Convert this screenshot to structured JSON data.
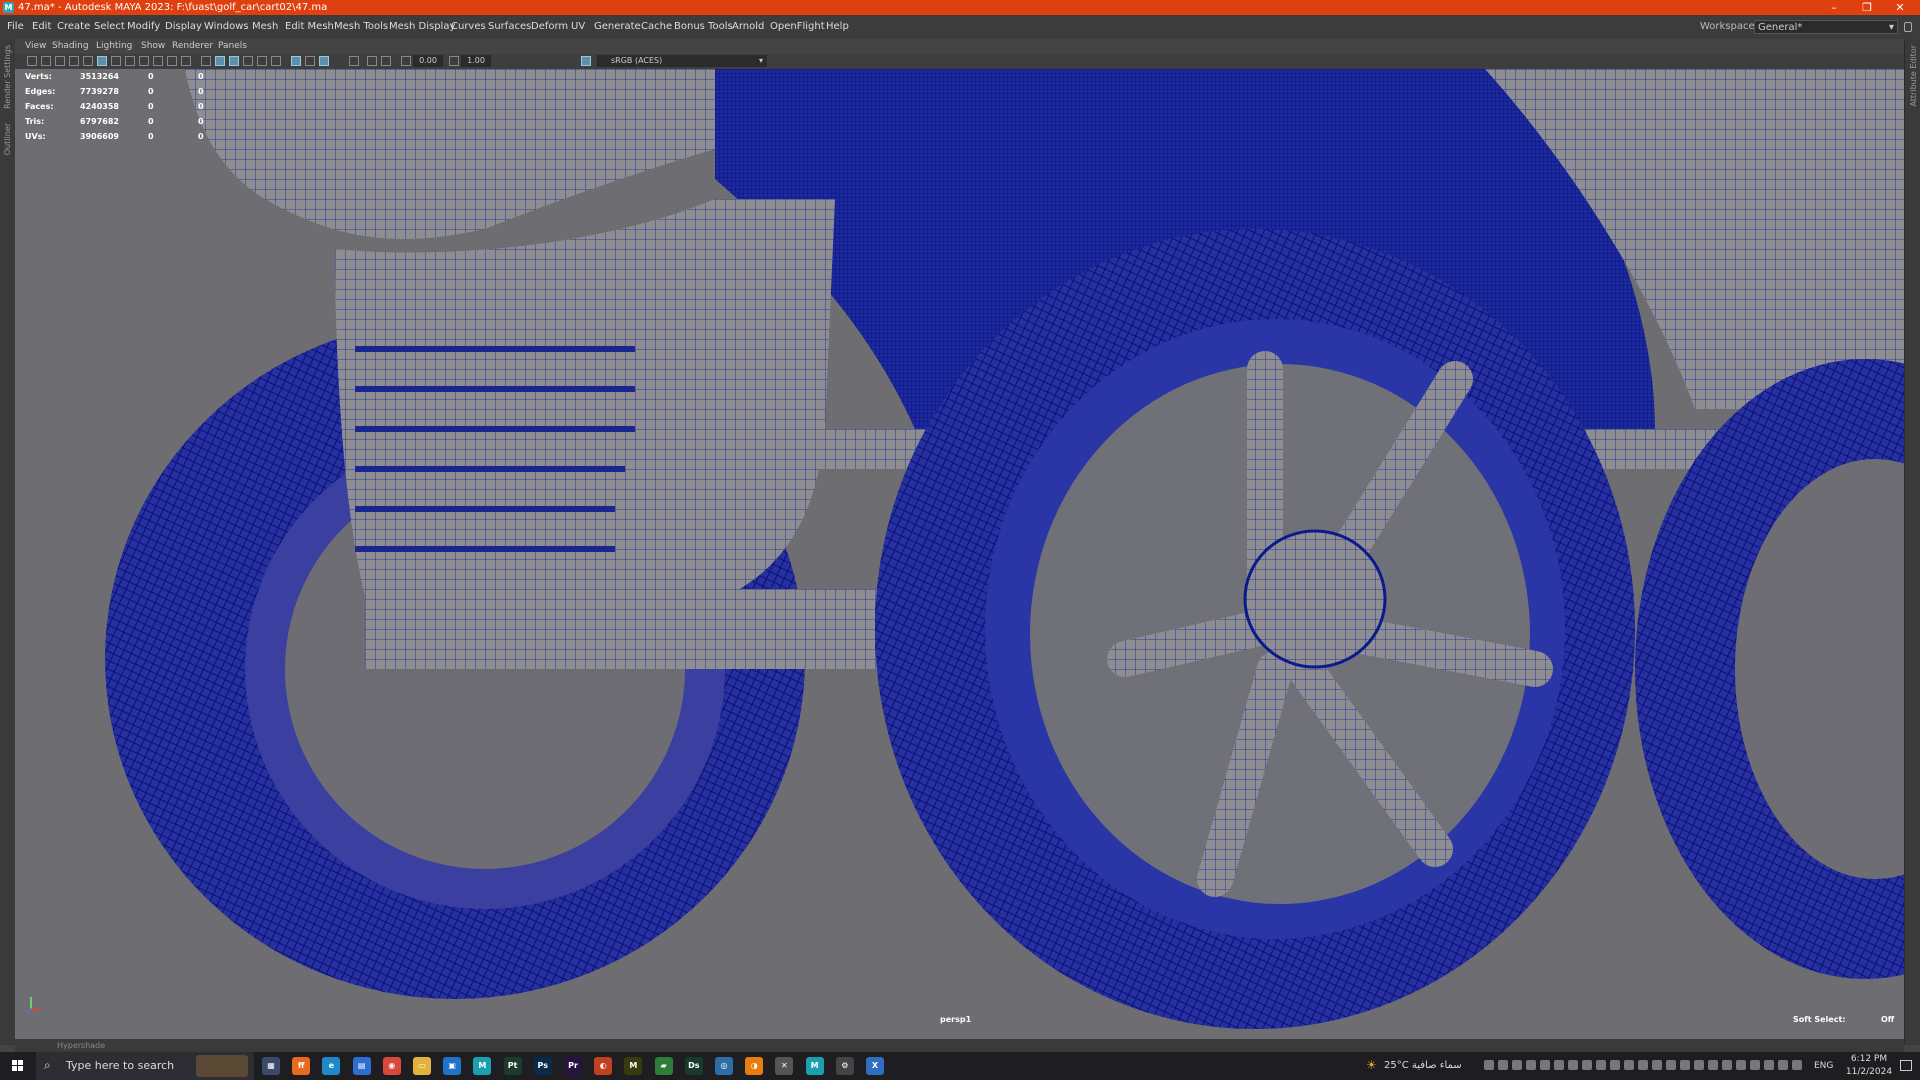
{
  "window": {
    "title": "47.ma* - Autodesk MAYA 2023: F:\\fuast\\golf_car\\cart02\\47.ma",
    "minimize": "–",
    "maximize": "❐",
    "close": "✕"
  },
  "menubar": {
    "items": [
      "File",
      "Edit",
      "Create",
      "Select",
      "Modify",
      "Display",
      "Windows",
      "Mesh",
      "Edit Mesh",
      "Mesh Tools",
      "Mesh Display",
      "Curves",
      "Surfaces",
      "Deform",
      "UV",
      "Generate",
      "Cache",
      "Bonus Tools",
      "Arnold",
      "OpenFlight",
      "Help"
    ],
    "workspace_label": "Workspace:",
    "workspace_value": "General*"
  },
  "side_tabs": {
    "left": [
      "Render Settings",
      "Outliner"
    ],
    "right": "Attribute Editor"
  },
  "panel_menu": [
    "View",
    "Shading",
    "Lighting",
    "Show",
    "Renderer",
    "Panels"
  ],
  "panel_toolbar": {
    "exposure": "0.00",
    "gamma": "1.00",
    "color_space": "sRGB (ACES)"
  },
  "hud": {
    "rows": [
      {
        "label": "Verts:",
        "value": "3513264",
        "sel": "0",
        "comp": "0"
      },
      {
        "label": "Edges:",
        "value": "7739278",
        "sel": "0",
        "comp": "0"
      },
      {
        "label": "Faces:",
        "value": "4240358",
        "sel": "0",
        "comp": "0"
      },
      {
        "label": "Tris:",
        "value": "6797682",
        "sel": "0",
        "comp": "0"
      },
      {
        "label": "UVs:",
        "value": "3906609",
        "sel": "0",
        "comp": "0"
      }
    ],
    "camera": "persp1",
    "soft_select_label": "Soft Select:",
    "soft_select_value": "Off"
  },
  "bottom_bar": {
    "label": "Hypershade"
  },
  "taskbar": {
    "search_placeholder": "Type here to search",
    "apps": [
      {
        "name": "task-view",
        "label": "▦",
        "color": "#3b4a6b"
      },
      {
        "name": "firefox",
        "label": "ff",
        "color": "#e66b1f"
      },
      {
        "name": "edge",
        "label": "e",
        "color": "#1e88c9"
      },
      {
        "name": "store",
        "label": "▤",
        "color": "#2d6fd1"
      },
      {
        "name": "chrome",
        "label": "◉",
        "color": "#d9483b"
      },
      {
        "name": "file-explorer",
        "label": "▭",
        "color": "#e2b33a"
      },
      {
        "name": "app-blue",
        "label": "▣",
        "color": "#1f73c9"
      },
      {
        "name": "maya-active",
        "label": "M",
        "color": "#1aa0b0"
      },
      {
        "name": "painter",
        "label": "Pt",
        "color": "#1c3b2a"
      },
      {
        "name": "photoshop",
        "label": "Ps",
        "color": "#0b2a4a"
      },
      {
        "name": "premiere",
        "label": "Pr",
        "color": "#2a1240"
      },
      {
        "name": "app-red",
        "label": "◐",
        "color": "#c2401f"
      },
      {
        "name": "marvelous",
        "label": "M",
        "color": "#3a3a10"
      },
      {
        "name": "app-green",
        "label": "▰",
        "color": "#2f7d3a"
      },
      {
        "name": "designer",
        "label": "Ds",
        "color": "#163a2b"
      },
      {
        "name": "app-circle",
        "label": "◎",
        "color": "#2c6fa8"
      },
      {
        "name": "blender",
        "label": "◑",
        "color": "#e87d0d"
      },
      {
        "name": "app-x",
        "label": "✕",
        "color": "#555555"
      },
      {
        "name": "maya-2",
        "label": "M",
        "color": "#1aa0b0"
      },
      {
        "name": "app-gear",
        "label": "⚙",
        "color": "#444444"
      },
      {
        "name": "app-xb",
        "label": "X",
        "color": "#2f6fc1"
      }
    ],
    "weather": "25°C  سماء صافية",
    "language": "ENG",
    "time": "6:12 PM",
    "date": "11/2/2024"
  },
  "colors": {
    "title_bar": "#e0400f",
    "wire": "#0a1a8c",
    "mesh": "#8a8a8e"
  }
}
